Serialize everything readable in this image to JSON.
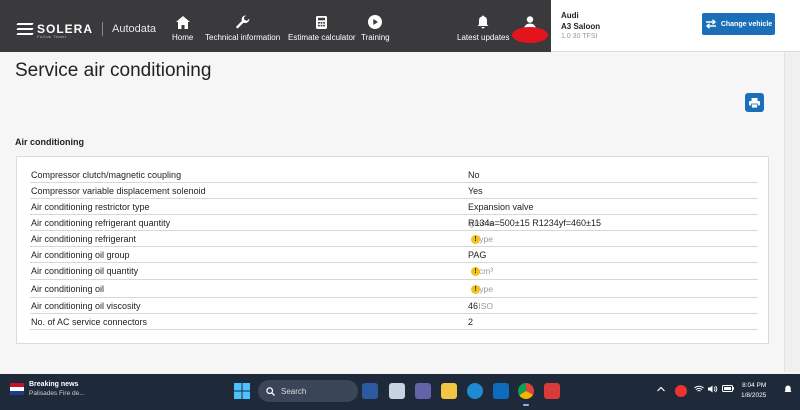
{
  "brand": {
    "name": "SOLERA",
    "tagline": "Follow Teamt",
    "product": "Autodata"
  },
  "nav": [
    {
      "id": "home",
      "label": "Home",
      "icon": "home-icon"
    },
    {
      "id": "technical",
      "label": "Technical information",
      "icon": "wrench-icon"
    },
    {
      "id": "estimate",
      "label": "Estimate calculator",
      "icon": "calculator-icon"
    },
    {
      "id": "training",
      "label": "Training",
      "icon": "play-icon"
    },
    {
      "id": "updates",
      "label": "Latest updates",
      "icon": "bell-icon"
    }
  ],
  "user": {
    "icon": "user-icon"
  },
  "vehicle": {
    "make": "Audi",
    "model": "A3 Saloon",
    "engine": "1.0 30 TFSI",
    "change_label": "Change vehicle"
  },
  "page": {
    "title": "Service air conditioning",
    "section": "Air conditioning"
  },
  "rows": [
    {
      "label": "Compressor clutch/magnetic coupling",
      "unit": "",
      "value": "No"
    },
    {
      "label": "Compressor variable displacement solenoid",
      "unit": "",
      "value": "Yes"
    },
    {
      "label": "Air conditioning restrictor type",
      "unit": "",
      "value": "Expansion valve"
    },
    {
      "label": "Air conditioning refrigerant quantity",
      "unit": "grams",
      "value": "R134a=500±15 R1234yf=460±15"
    },
    {
      "label": "Air conditioning refrigerant",
      "unit": "Type",
      "value": "",
      "warning": true
    },
    {
      "label": "Air conditioning oil group",
      "unit": "",
      "value": "PAG"
    },
    {
      "label": "Air conditioning oil quantity",
      "unit": "cm³",
      "value": "",
      "warning": true
    },
    {
      "label": "Air conditioning oil",
      "unit": "Type",
      "value": "",
      "warning": true
    },
    {
      "label": "Air conditioning oil viscosity",
      "unit": "ISO",
      "value": "46"
    },
    {
      "label": "No. of AC service connectors",
      "unit": "",
      "value": "2"
    }
  ],
  "taskbar": {
    "news_title": "Breaking news",
    "news_sub": "Palisades Fire de...",
    "search_placeholder": "Search",
    "time": "8:04 PM",
    "date": "1/8/2025"
  },
  "colors": {
    "nav_bg": "#3a3a3c",
    "accent": "#1a6fb8",
    "warning": "#f3c21b"
  }
}
